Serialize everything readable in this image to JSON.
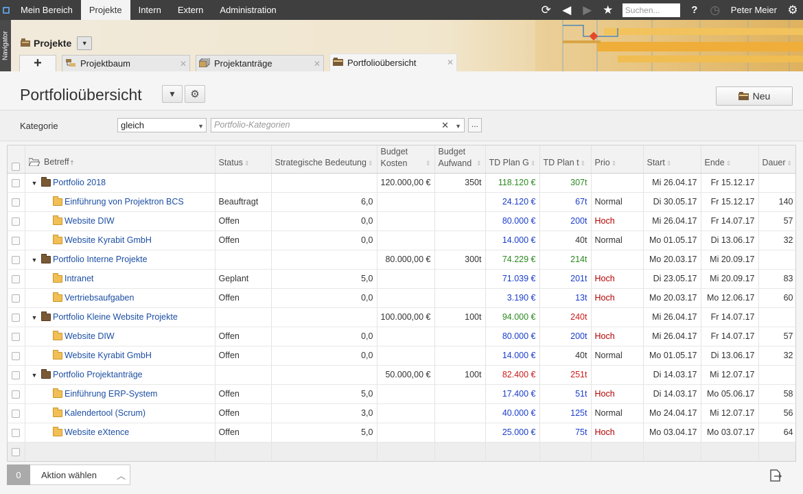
{
  "topbar": {
    "menu": [
      "Mein Bereich",
      "Projekte",
      "Intern",
      "Extern",
      "Administration"
    ],
    "active_index": 1,
    "search_placeholder": "Suchen...",
    "help": "?",
    "user": "Peter Meier",
    "icons": [
      "refresh-icon",
      "back-icon",
      "forward-icon",
      "star-icon",
      "help-icon",
      "stopwatch-icon",
      "gear-icon"
    ]
  },
  "navigator_label": "Navigator",
  "section": {
    "title": "Projekte",
    "tab_add": "+",
    "tabs": [
      {
        "label": "Projektbaum",
        "icon": "project-tree-icon"
      },
      {
        "label": "Projektanträge",
        "icon": "project-request-icon"
      },
      {
        "label": "Portfolioübersicht",
        "icon": "portfolio-icon"
      }
    ]
  },
  "page": {
    "title": "Portfolioübersicht",
    "new_label": "Neu"
  },
  "filter": {
    "label": "Kategorie",
    "operator": "gleich",
    "category_placeholder": "Portfolio-Kategorien",
    "more": "..."
  },
  "table": {
    "headers": [
      "Betreff",
      "Status",
      "Strategische Bedeutung",
      "Budget Kosten",
      "Budget Aufwand",
      "TD Plan G",
      "TD Plan t",
      "Prio",
      "Start",
      "Ende",
      "Dauer"
    ],
    "header_budget_kosten": [
      "Budget",
      "Kosten"
    ],
    "header_budget_aufwand": [
      "Budget",
      "Aufwand"
    ],
    "rows": [
      {
        "type": "portfolio",
        "name": "Portfolio 2018",
        "status": "",
        "bed": "",
        "kosten": "120.000,00 €",
        "aufwand": "350t",
        "tdg": "118.120 €",
        "tdg_color": "green",
        "tdt": "307t",
        "tdt_color": "green",
        "prio": "",
        "start": "Mi 26.04.17",
        "ende": "Fr 15.12.17",
        "dauer": ""
      },
      {
        "type": "project",
        "name": "Einführung von Projektron BCS",
        "status": "Beauftragt",
        "bed": "6,0",
        "kosten": "",
        "aufwand": "",
        "tdg": "24.120 €",
        "tdg_color": "blue",
        "tdt": "67t",
        "tdt_color": "blue",
        "prio": "Normal",
        "start": "Di 30.05.17",
        "ende": "Fr 15.12.17",
        "dauer": "140"
      },
      {
        "type": "project",
        "name": "Website DIW",
        "status": "Offen",
        "bed": "0,0",
        "kosten": "",
        "aufwand": "",
        "tdg": "80.000 €",
        "tdg_color": "blue",
        "tdt": "200t",
        "tdt_color": "blue",
        "prio": "Hoch",
        "start": "Mi 26.04.17",
        "ende": "Fr 14.07.17",
        "dauer": "57"
      },
      {
        "type": "project",
        "name": "Website Kyrabit GmbH",
        "status": "Offen",
        "bed": "0,0",
        "kosten": "",
        "aufwand": "",
        "tdg": "14.000 €",
        "tdg_color": "blue",
        "tdt": "40t",
        "tdt_color": "black",
        "prio": "Normal",
        "start": "Mo 01.05.17",
        "ende": "Di 13.06.17",
        "dauer": "32"
      },
      {
        "type": "portfolio",
        "name": "Portfolio Interne Projekte",
        "status": "",
        "bed": "",
        "kosten": "80.000,00 €",
        "aufwand": "300t",
        "tdg": "74.229 €",
        "tdg_color": "green",
        "tdt": "214t",
        "tdt_color": "green",
        "prio": "",
        "start": "Mo 20.03.17",
        "ende": "Mi 20.09.17",
        "dauer": ""
      },
      {
        "type": "project",
        "name": "Intranet",
        "status": "Geplant",
        "bed": "5,0",
        "kosten": "",
        "aufwand": "",
        "tdg": "71.039 €",
        "tdg_color": "blue",
        "tdt": "201t",
        "tdt_color": "blue",
        "prio": "Hoch",
        "start": "Di 23.05.17",
        "ende": "Mi 20.09.17",
        "dauer": "83"
      },
      {
        "type": "project",
        "name": "Vertriebsaufgaben",
        "status": "Offen",
        "bed": "0,0",
        "kosten": "",
        "aufwand": "",
        "tdg": "3.190 €",
        "tdg_color": "blue",
        "tdt": "13t",
        "tdt_color": "blue",
        "prio": "Hoch",
        "start": "Mo 20.03.17",
        "ende": "Mo 12.06.17",
        "dauer": "60"
      },
      {
        "type": "portfolio",
        "name": "Portfolio Kleine Website Projekte",
        "status": "",
        "bed": "",
        "kosten": "100.000,00 €",
        "aufwand": "100t",
        "tdg": "94.000 €",
        "tdg_color": "green",
        "tdt": "240t",
        "tdt_color": "red",
        "prio": "",
        "start": "Mi 26.04.17",
        "ende": "Fr 14.07.17",
        "dauer": ""
      },
      {
        "type": "project",
        "name": "Website DIW",
        "status": "Offen",
        "bed": "0,0",
        "kosten": "",
        "aufwand": "",
        "tdg": "80.000 €",
        "tdg_color": "blue",
        "tdt": "200t",
        "tdt_color": "blue",
        "prio": "Hoch",
        "start": "Mi 26.04.17",
        "ende": "Fr 14.07.17",
        "dauer": "57"
      },
      {
        "type": "project",
        "name": "Website Kyrabit GmbH",
        "status": "Offen",
        "bed": "0,0",
        "kosten": "",
        "aufwand": "",
        "tdg": "14.000 €",
        "tdg_color": "blue",
        "tdt": "40t",
        "tdt_color": "black",
        "prio": "Normal",
        "start": "Mo 01.05.17",
        "ende": "Di 13.06.17",
        "dauer": "32"
      },
      {
        "type": "portfolio",
        "name": "Portfolio Projektanträge",
        "status": "",
        "bed": "",
        "kosten": "50.000,00 €",
        "aufwand": "100t",
        "tdg": "82.400 €",
        "tdg_color": "red",
        "tdt": "251t",
        "tdt_color": "red",
        "prio": "",
        "start": "Di 14.03.17",
        "ende": "Mi 12.07.17",
        "dauer": ""
      },
      {
        "type": "project",
        "name": "Einführung ERP-System",
        "status": "Offen",
        "bed": "5,0",
        "kosten": "",
        "aufwand": "",
        "tdg": "17.400 €",
        "tdg_color": "blue",
        "tdt": "51t",
        "tdt_color": "blue",
        "prio": "Hoch",
        "start": "Di 14.03.17",
        "ende": "Mo 05.06.17",
        "dauer": "58"
      },
      {
        "type": "project",
        "name": "Kalendertool (Scrum)",
        "status": "Offen",
        "bed": "3,0",
        "kosten": "",
        "aufwand": "",
        "tdg": "40.000 €",
        "tdg_color": "blue",
        "tdt": "125t",
        "tdt_color": "blue",
        "prio": "Normal",
        "start": "Mo 24.04.17",
        "ende": "Mi 12.07.17",
        "dauer": "56"
      },
      {
        "type": "project",
        "name": "Website eXtence",
        "status": "Offen",
        "bed": "5,0",
        "kosten": "",
        "aufwand": "",
        "tdg": "25.000 €",
        "tdg_color": "blue",
        "tdt": "75t",
        "tdt_color": "blue",
        "prio": "Hoch",
        "start": "Mo 03.04.17",
        "ende": "Mo 03.07.17",
        "dauer": "64"
      }
    ]
  },
  "bottom": {
    "count": "0",
    "action": "Aktion wählen"
  },
  "colors": {
    "topbar": "#3f3f3f",
    "link": "#1d4fa3",
    "blue": "#1a3dcc",
    "green": "#2b8a1f",
    "red": "#cc1a1a",
    "accent_orange": "#e8a93a"
  }
}
